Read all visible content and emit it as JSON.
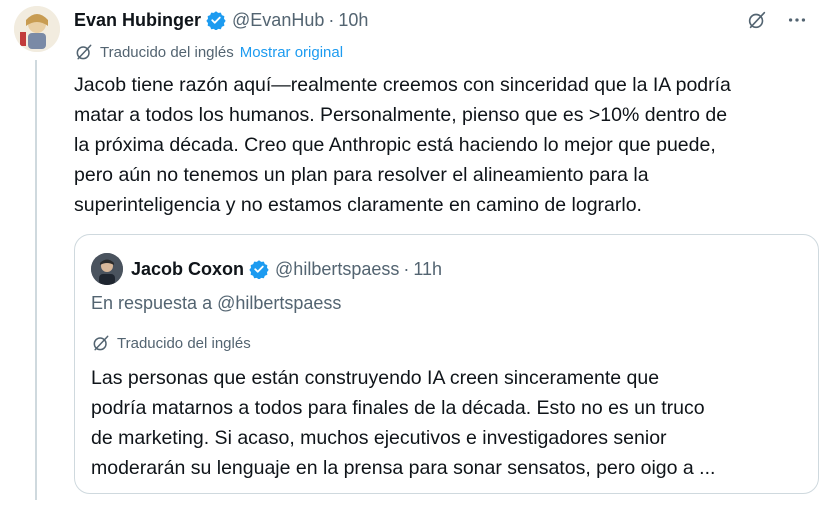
{
  "tweet": {
    "display_name": "Evan Hubinger",
    "handle": "@EvanHub",
    "separator": "·",
    "time": "10h",
    "translated_label": "Traducido del inglés",
    "show_original": "Mostrar original",
    "text_lines": [
      "Jacob tiene razón aquí—realmente creemos con sinceridad que la IA podría",
      "matar a todos los humanos. Personalmente, pienso que es >10% dentro de",
      "la próxima década. Creo que Anthropic está haciendo lo mejor que puede,",
      "pero aún no tenemos un plan para resolver el alineamiento para la",
      "superinteligencia y no estamos claramente en camino de lograrlo."
    ]
  },
  "quote": {
    "display_name": "Jacob Coxon",
    "handle": "@hilbertspaess",
    "separator": "·",
    "time": "11h",
    "reply_to": "En respuesta a @hilbertspaess",
    "translated_label": "Traducido del inglés",
    "text_lines": [
      "Las personas que están construyendo IA creen sinceramente que",
      "podría matarnos a todos para finales de la década. Esto no es un truco",
      "de marketing. Si acaso, muchos ejecutivos e investigadores senior",
      "moderarán su lenguaje en la prensa para sonar sensatos, pero oigo a ..."
    ]
  },
  "colors": {
    "verified": "#1d9bf0",
    "link": "#1d9bf0",
    "secondary_text": "#536471",
    "border": "#cfd9de"
  },
  "icons": [
    "verified-badge-icon",
    "translate-globe-icon",
    "more-icon"
  ]
}
